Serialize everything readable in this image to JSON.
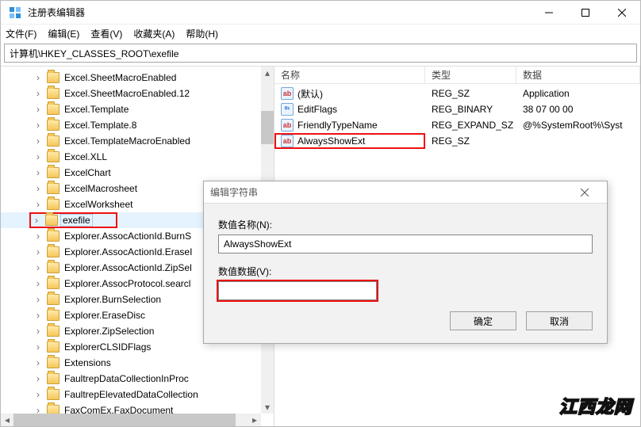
{
  "window": {
    "title": "注册表编辑器"
  },
  "menu": {
    "file": "文件(F)",
    "edit": "编辑(E)",
    "view": "查看(V)",
    "favorites": "收藏夹(A)",
    "help": "帮助(H)"
  },
  "address": {
    "path": "计算机\\HKEY_CLASSES_ROOT\\exefile"
  },
  "tree": {
    "items": [
      {
        "label": "Excel.SheetMacroEnabled"
      },
      {
        "label": "Excel.SheetMacroEnabled.12"
      },
      {
        "label": "Excel.Template"
      },
      {
        "label": "Excel.Template.8"
      },
      {
        "label": "Excel.TemplateMacroEnabled"
      },
      {
        "label": "Excel.XLL"
      },
      {
        "label": "ExcelChart"
      },
      {
        "label": "ExcelMacrosheet"
      },
      {
        "label": "ExcelWorksheet"
      },
      {
        "label": "exefile",
        "selected": true,
        "highlight": true
      },
      {
        "label": "Explorer.AssocActionId.BurnSelection",
        "clip": "Explorer.AssocActionId.BurnS"
      },
      {
        "label": "Explorer.AssocActionId.EraseDisc",
        "clip": "Explorer.AssocActionId.EraseI"
      },
      {
        "label": "Explorer.AssocActionId.ZipSelection",
        "clip": "Explorer.AssocActionId.ZipSel"
      },
      {
        "label": "Explorer.AssocProtocol.search-ms",
        "clip": "Explorer.AssocProtocol.searcl"
      },
      {
        "label": "Explorer.BurnSelection"
      },
      {
        "label": "Explorer.EraseDisc"
      },
      {
        "label": "Explorer.ZipSelection"
      },
      {
        "label": "ExplorerCLSIDFlags"
      },
      {
        "label": "Extensions"
      },
      {
        "label": "FaultrepDataCollectionInProc"
      },
      {
        "label": "FaultrepElevatedDataCollection"
      },
      {
        "label": "FaxComEx.FaxDocument"
      }
    ]
  },
  "columns": {
    "name": "名称",
    "type": "类型",
    "data": "数据"
  },
  "values": [
    {
      "icon": "sz",
      "name": "(默认)",
      "type": "REG_SZ",
      "data": "Application"
    },
    {
      "icon": "bin",
      "name": "EditFlags",
      "type": "REG_BINARY",
      "data": "38 07 00 00"
    },
    {
      "icon": "sz",
      "name": "FriendlyTypeName",
      "type": "REG_EXPAND_SZ",
      "data": "@%SystemRoot%\\Syst"
    },
    {
      "icon": "sz",
      "name": "AlwaysShowExt",
      "type": "REG_SZ",
      "data": "",
      "highlight": true
    }
  ],
  "dialog": {
    "title": "编辑字符串",
    "name_label": "数值名称(N):",
    "name_value": "AlwaysShowExt",
    "data_label": "数值数据(V):",
    "data_value": "",
    "ok": "确定",
    "cancel": "取消"
  },
  "watermark": "江西龙网"
}
